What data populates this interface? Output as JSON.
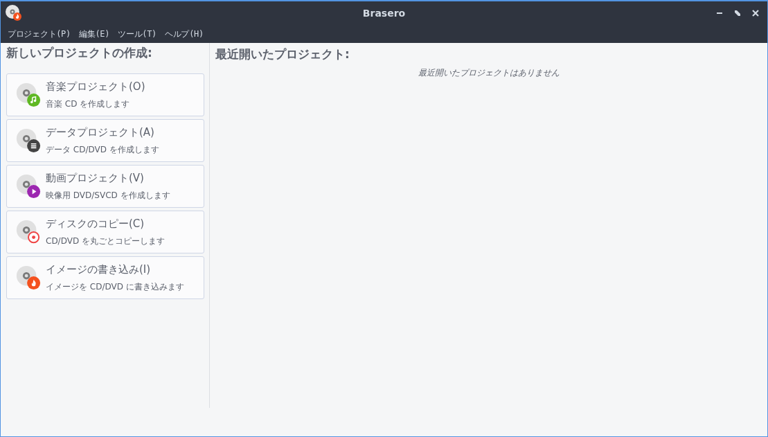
{
  "window": {
    "title": "Brasero"
  },
  "menu": [
    "プロジェクト(P)",
    "編集(E)",
    "ツール(T)",
    "ヘルプ(H)"
  ],
  "new_project": {
    "heading": "新しいプロジェクトの作成:",
    "items": [
      {
        "kind": "audio",
        "title": "音楽プロジェクト(O)",
        "description": "音楽 CD を作成します"
      },
      {
        "kind": "data",
        "title": "データプロジェクト(A)",
        "description": "データ CD/DVD を作成します"
      },
      {
        "kind": "video",
        "title": "動画プロジェクト(V)",
        "description": "映像用 DVD/SVCD を作成します"
      },
      {
        "kind": "copy",
        "title": "ディスクのコピー(C)",
        "description": "CD/DVD を丸ごとコピーします"
      },
      {
        "kind": "burn",
        "title": "イメージの書き込み(I)",
        "description": "イメージを CD/DVD に書き込みます"
      }
    ]
  },
  "recent": {
    "heading": "最近開いたプロジェクト:",
    "empty_message": "最近開いたプロジェクトはありません"
  }
}
